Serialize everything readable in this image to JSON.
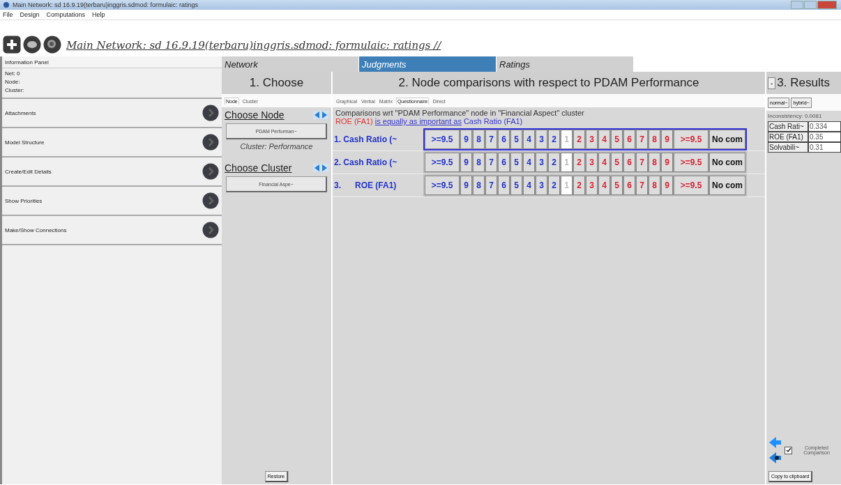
{
  "window": {
    "title": "Main Network: sd 16.9.19(terbaru)inggris.sdmod: formulaic: ratings"
  },
  "menu": [
    "File",
    "Design",
    "Computations",
    "Help"
  ],
  "toolbar": {
    "path": "Main Network: sd 16.9.19(terbaru)inggris.sdmod: formulaic: ratings //"
  },
  "info_panel": {
    "title": "Information Panel",
    "lines": [
      "Net: 0",
      "Node:",
      "Cluster:"
    ],
    "items": [
      "Attachments",
      "Model Structure",
      "Create/Edit Details",
      "Show Priorities",
      "Make/Show Connections"
    ]
  },
  "top_tabs": [
    {
      "label": "Network",
      "selected": false
    },
    {
      "label": "Judgments",
      "selected": true
    },
    {
      "label": "Ratings",
      "selected": false
    }
  ],
  "choose": {
    "title": "1. Choose",
    "tabs": [
      {
        "label": "Node",
        "selected": true
      },
      {
        "label": "Cluster",
        "selected": false
      }
    ],
    "node_heading": "Choose Node",
    "node_value": "PDAM Performan~",
    "cluster_caption": "Cluster: Performance",
    "cluster_heading": "Choose Cluster",
    "cluster_value": "Financial Aspe~",
    "restore": "Restore"
  },
  "comparisons": {
    "title": "2. Node comparisons with respect to PDAM Performance",
    "tabs": [
      {
        "label": "Graphical",
        "selected": false
      },
      {
        "label": "Verbal",
        "selected": false
      },
      {
        "label": "Matrix",
        "selected": false
      },
      {
        "label": "Questionnaire",
        "selected": true
      },
      {
        "label": "Direct",
        "selected": false
      }
    ],
    "description": "Comparisons wrt \"PDAM Performance\" node in \"Financial Aspect\" cluster",
    "verdict": {
      "left": "ROE (FA1)",
      "middle": "is equally as important as",
      "right": "Cash Ratio (FA1)"
    },
    "rows": [
      {
        "label": "1. Cash Ratio (~",
        "selected": true,
        "cells": [
          {
            "kind": "left",
            "label": ">=9.5",
            "selected": false
          },
          {
            "kind": "left",
            "label": "9",
            "selected": false
          },
          {
            "kind": "left",
            "label": "8",
            "selected": false
          },
          {
            "kind": "left",
            "label": "7",
            "selected": false
          },
          {
            "kind": "left",
            "label": "6",
            "selected": false
          },
          {
            "kind": "left",
            "label": "5",
            "selected": false
          },
          {
            "kind": "left",
            "label": "4",
            "selected": false
          },
          {
            "kind": "left",
            "label": "3",
            "selected": false
          },
          {
            "kind": "left",
            "label": "2",
            "selected": false
          },
          {
            "kind": "equal",
            "label": "1",
            "selected": true
          },
          {
            "kind": "right",
            "label": "2",
            "selected": false
          },
          {
            "kind": "right",
            "label": "3",
            "selected": false
          },
          {
            "kind": "right",
            "label": "4",
            "selected": false
          },
          {
            "kind": "right",
            "label": "5",
            "selected": false
          },
          {
            "kind": "right",
            "label": "6",
            "selected": false
          },
          {
            "kind": "right",
            "label": "7",
            "selected": false
          },
          {
            "kind": "right",
            "label": "8",
            "selected": false
          },
          {
            "kind": "right",
            "label": "9",
            "selected": false
          },
          {
            "kind": "right",
            "label": ">=9.5",
            "selected": false
          },
          {
            "kind": "none",
            "label": "No com",
            "selected": false
          }
        ]
      },
      {
        "label": "2. Cash Ratio (~",
        "selected": false,
        "cells": [
          {
            "kind": "left",
            "label": ">=9.5",
            "selected": false
          },
          {
            "kind": "left",
            "label": "9",
            "selected": false
          },
          {
            "kind": "left",
            "label": "8",
            "selected": false
          },
          {
            "kind": "left",
            "label": "7",
            "selected": false
          },
          {
            "kind": "left",
            "label": "6",
            "selected": false
          },
          {
            "kind": "left",
            "label": "5",
            "selected": false
          },
          {
            "kind": "left",
            "label": "4",
            "selected": false
          },
          {
            "kind": "left",
            "label": "3",
            "selected": false
          },
          {
            "kind": "left",
            "label": "2",
            "selected": false
          },
          {
            "kind": "equal",
            "label": "1",
            "selected": true
          },
          {
            "kind": "right",
            "label": "2",
            "selected": false
          },
          {
            "kind": "right",
            "label": "3",
            "selected": false
          },
          {
            "kind": "right",
            "label": "4",
            "selected": false
          },
          {
            "kind": "right",
            "label": "5",
            "selected": false
          },
          {
            "kind": "right",
            "label": "6",
            "selected": false
          },
          {
            "kind": "right",
            "label": "7",
            "selected": false
          },
          {
            "kind": "right",
            "label": "8",
            "selected": false
          },
          {
            "kind": "right",
            "label": "9",
            "selected": false
          },
          {
            "kind": "right",
            "label": ">=9.5",
            "selected": false
          },
          {
            "kind": "none",
            "label": "No com",
            "selected": false
          }
        ]
      },
      {
        "label": "3.      ROE (FA1)",
        "selected": false,
        "cells": [
          {
            "kind": "left",
            "label": ">=9.5",
            "selected": false
          },
          {
            "kind": "left",
            "label": "9",
            "selected": false
          },
          {
            "kind": "left",
            "label": "8",
            "selected": false
          },
          {
            "kind": "left",
            "label": "7",
            "selected": false
          },
          {
            "kind": "left",
            "label": "6",
            "selected": false
          },
          {
            "kind": "left",
            "label": "5",
            "selected": false
          },
          {
            "kind": "left",
            "label": "4",
            "selected": false
          },
          {
            "kind": "left",
            "label": "3",
            "selected": false
          },
          {
            "kind": "left",
            "label": "2",
            "selected": false
          },
          {
            "kind": "equal",
            "label": "1",
            "selected": true
          },
          {
            "kind": "right",
            "label": "2",
            "selected": false
          },
          {
            "kind": "right",
            "label": "3",
            "selected": false
          },
          {
            "kind": "right",
            "label": "4",
            "selected": false
          },
          {
            "kind": "right",
            "label": "5",
            "selected": false
          },
          {
            "kind": "right",
            "label": "6",
            "selected": false
          },
          {
            "kind": "right",
            "label": "7",
            "selected": false
          },
          {
            "kind": "right",
            "label": "8",
            "selected": false
          },
          {
            "kind": "right",
            "label": "9",
            "selected": false
          },
          {
            "kind": "right",
            "label": ">=9.5",
            "selected": false
          },
          {
            "kind": "none",
            "label": "No com",
            "selected": false
          }
        ]
      }
    ]
  },
  "results": {
    "collapse": "-",
    "title": "3. Results",
    "modes": [
      "normal~",
      "hybrid~"
    ],
    "inconsistency": "Inconsistency: 0.0081",
    "rows": [
      {
        "name": "Cash Rati~",
        "value": "0.334"
      },
      {
        "name": "ROE (FA1)",
        "value": "0.35"
      },
      {
        "name": "Solvabili~",
        "value": "0.31"
      }
    ],
    "completed": {
      "label": "Completed Comparison",
      "checked": true
    },
    "copy": "Copy to clipboard"
  }
}
